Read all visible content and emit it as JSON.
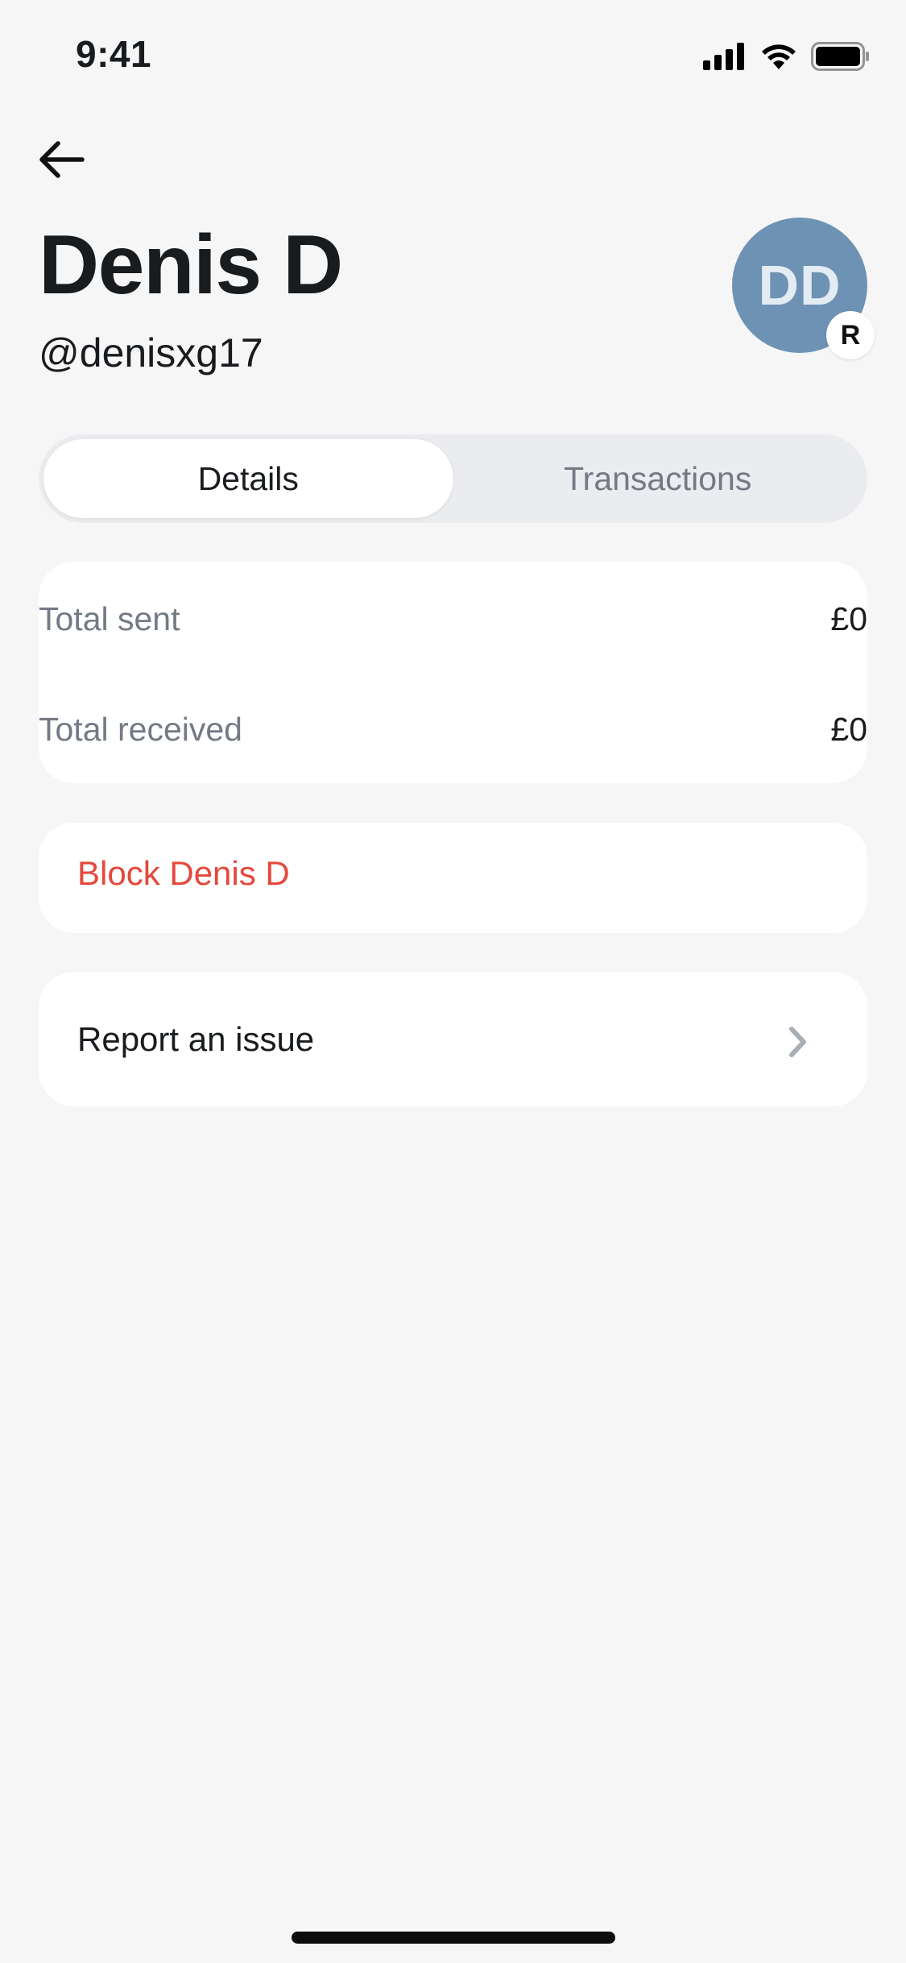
{
  "status_bar": {
    "time": "9:41"
  },
  "profile": {
    "name": "Denis D",
    "username": "@denisxg17",
    "avatar_initials": "DD",
    "badge_letter": "R",
    "avatar_color": "#6e92b4"
  },
  "tabs": [
    {
      "label": "Details",
      "active": true
    },
    {
      "label": "Transactions",
      "active": false
    }
  ],
  "stats": [
    {
      "label": "Total sent",
      "value": "£0"
    },
    {
      "label": "Total received",
      "value": "£0"
    }
  ],
  "actions": {
    "block_label": "Block Denis D",
    "report_label": "Report an issue"
  },
  "colors": {
    "danger": "#e5483c",
    "background": "#f6f6f7",
    "muted_text": "#737a85"
  }
}
